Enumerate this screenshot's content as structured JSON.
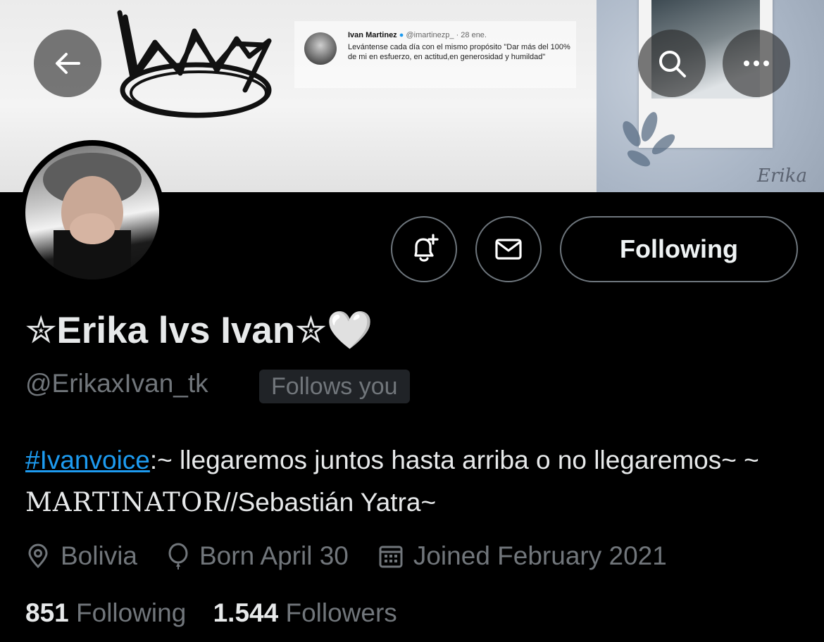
{
  "banner": {
    "tweet": {
      "author": "Ivan Martinez",
      "handle": "@imartinezp_",
      "date": "· 28 ene.",
      "text": "Levántense cada día con el mismo propósito \"Dar más del 100% de mi en esfuerzo, en actitud,en generosidad y humildad\""
    },
    "signature": "Erika"
  },
  "header": {
    "back_icon": "arrow-left-icon",
    "search_icon": "search-icon",
    "more_icon": "more-horizontal-icon"
  },
  "actions": {
    "notify_icon": "bell-plus-icon",
    "message_icon": "mail-icon",
    "following_label": "Following"
  },
  "profile": {
    "display_name": "✮Erika lvs Ivan✮🤍",
    "handle": "@ErikaxIvan_tk",
    "follows_you": "Follows you",
    "bio_hashtag": "#Ivanvoice",
    "bio_part1": ":~ llegaremos juntos hasta arriba o no llegaremos~ ~ ",
    "bio_fancy": "MARTINATOR",
    "bio_part2": "//Sebastián Yatra~",
    "location": "Bolivia",
    "birthday": "Born April 30",
    "joined": "Joined February 2021",
    "following_count": "851",
    "following_label": "Following",
    "followers_count": "1.544",
    "followers_label": "Followers"
  },
  "colors": {
    "background": "#000000",
    "primary_text": "#e7e9ea",
    "secondary_text": "#71767b",
    "link": "#1d9bf0",
    "border": "#6e767d"
  }
}
